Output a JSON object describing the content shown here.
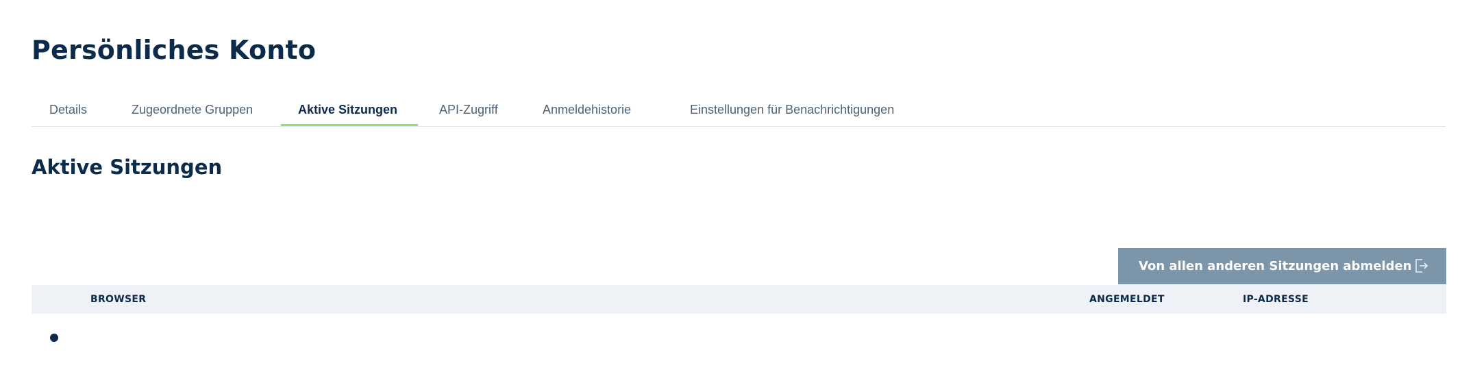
{
  "page": {
    "title": "Persönliches Konto"
  },
  "tabs": [
    {
      "label": "Details",
      "active": false
    },
    {
      "label": "Zugeordnete Gruppen",
      "active": false
    },
    {
      "label": "Aktive Sitzungen",
      "active": true
    },
    {
      "label": "API-Zugriff",
      "active": false
    },
    {
      "label": "Anmeldehistorie",
      "active": false
    },
    {
      "label": "Einstellungen für Benachrichtigungen",
      "active": false
    }
  ],
  "section": {
    "title": "Aktive Sitzungen"
  },
  "actions": {
    "logout_all_label": "Von allen anderen Sitzungen abmelden",
    "logout_icon": "logout-icon"
  },
  "table": {
    "columns": [
      "BROWSER",
      "ANGEMELDET",
      "IP-ADRESSE"
    ],
    "rows": [
      {
        "status_icon": "dot-icon",
        "browser": "",
        "logged_in": "",
        "ip": ""
      }
    ]
  },
  "colors": {
    "heading": "#0c2b4b",
    "tab_text": "#4f6274",
    "active_tab_underline": "#8ee37a",
    "button_bg": "#7d95a8",
    "table_header_bg": "#eef2f6"
  }
}
